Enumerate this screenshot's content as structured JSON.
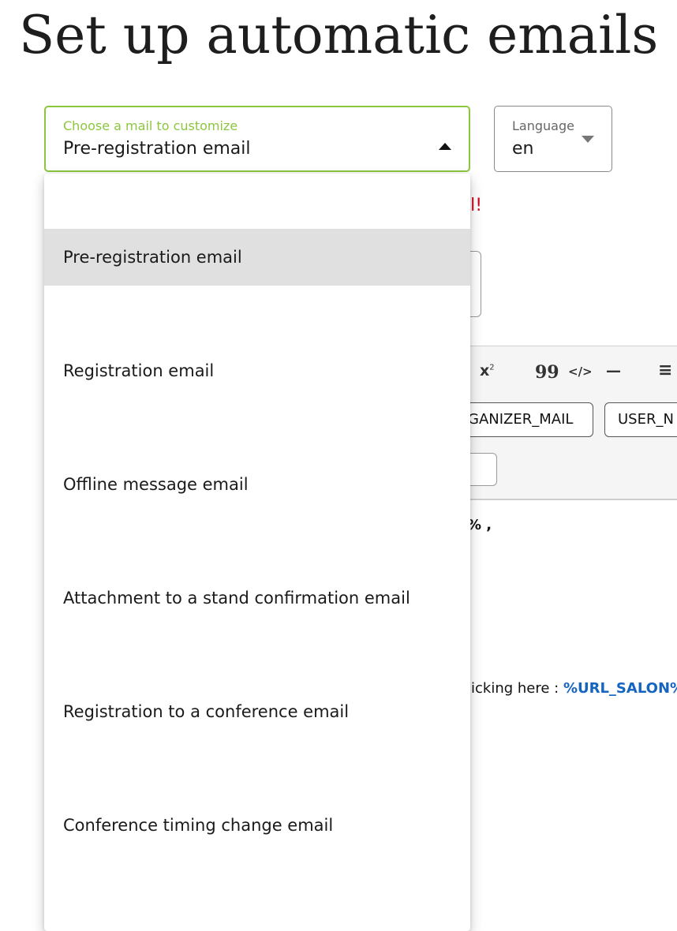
{
  "page": {
    "title": "Set up automatic emails"
  },
  "mail_select": {
    "label": "Choose a mail to customize",
    "value": "Pre-registration email",
    "options": [
      "Pre-registration email",
      "Registration email",
      "Offline message email",
      "Attachment to a stand confirmation email",
      "Registration to a conference email",
      "Conference timing change email"
    ],
    "selected_index": 0
  },
  "language_select": {
    "label": "Language",
    "value": "en"
  },
  "background": {
    "error_fragment": "il!",
    "toolbar": {
      "superscript": "x",
      "superscript_mark": "2",
      "quote": "99",
      "code": "</>",
      "rule": "—",
      "list": "≡"
    },
    "tags": [
      "GANIZER_MAIL",
      "USER_N"
    ],
    "editor": {
      "greeting_fragment": "% ,",
      "link_prefix": "licking here : ",
      "link_text": "%URL_SALON%"
    }
  },
  "colors": {
    "accent": "#8cc63f",
    "error": "#d0021b",
    "link": "#1565c0",
    "selected_option_bg": "#e0e0e0"
  }
}
